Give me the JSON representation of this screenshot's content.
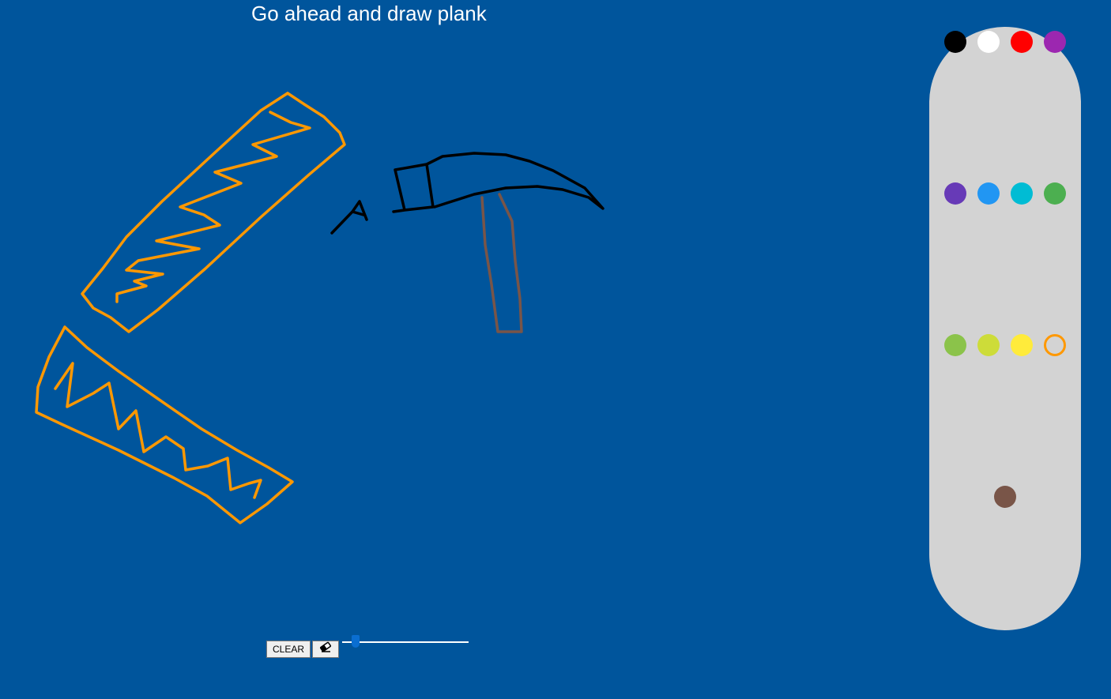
{
  "prompt": "Go ahead and draw plank",
  "palette": {
    "colors": [
      {
        "name": "black",
        "hex": "#000000"
      },
      {
        "name": "white",
        "hex": "#ffffff"
      },
      {
        "name": "red",
        "hex": "#ff0000"
      },
      {
        "name": "purple",
        "hex": "#9c27b0"
      },
      {
        "name": "deep-purple",
        "hex": "#673ab7"
      },
      {
        "name": "blue",
        "hex": "#2196f3"
      },
      {
        "name": "cyan",
        "hex": "#00bcd4"
      },
      {
        "name": "green",
        "hex": "#4caf50"
      },
      {
        "name": "light-green",
        "hex": "#8bc34a"
      },
      {
        "name": "lime",
        "hex": "#cddc39"
      },
      {
        "name": "yellow",
        "hex": "#ffeb3b"
      },
      {
        "name": "orange",
        "hex": "#ff9800"
      },
      {
        "name": "brown",
        "hex": "#795548"
      }
    ],
    "selected": "orange"
  },
  "controls": {
    "clear_label": "CLEAR",
    "eraser_icon": "eraser-icon",
    "brush_size": 0.04
  },
  "drawing_colors": {
    "plank": "#ff9800",
    "pickaxe_head": "#000000",
    "pickaxe_handle": "#795548"
  }
}
